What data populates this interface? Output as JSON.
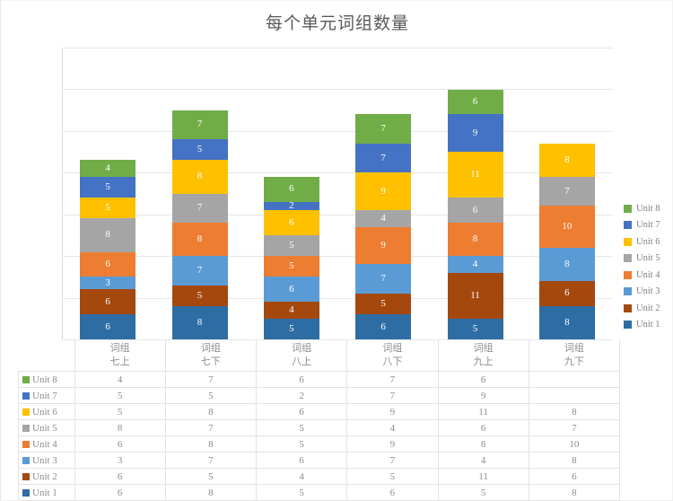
{
  "chart_data": {
    "type": "bar",
    "subtype": "stacked-column",
    "title": "每个单元词组数量",
    "xlabel": "",
    "ylabel": "",
    "ylim": [
      0,
      70
    ],
    "ytick_step": 10,
    "yticks": [
      0,
      10,
      20,
      30,
      40,
      50,
      60,
      70
    ],
    "grid": true,
    "legend_position": "right",
    "categories": [
      "词组\n七上",
      "词组\n七下",
      "词组\n八上",
      "词组\n八下",
      "词组\n九上",
      "词组\n九下"
    ],
    "category_lines": [
      [
        "词组",
        "七上"
      ],
      [
        "词组",
        "七下"
      ],
      [
        "词组",
        "八上"
      ],
      [
        "词组",
        "八下"
      ],
      [
        "词组",
        "九上"
      ],
      [
        "词组",
        "九下"
      ]
    ],
    "series": [
      {
        "name": "Unit 1",
        "color": "#2E6DA4",
        "values": [
          6,
          8,
          5,
          6,
          5,
          8
        ]
      },
      {
        "name": "Unit 2",
        "color": "#A5480E",
        "values": [
          6,
          5,
          4,
          5,
          11,
          6
        ]
      },
      {
        "name": "Unit 3",
        "color": "#5B9BD5",
        "values": [
          3,
          7,
          6,
          7,
          4,
          8
        ]
      },
      {
        "name": "Unit 4",
        "color": "#ED7D31",
        "values": [
          6,
          8,
          5,
          9,
          8,
          10
        ]
      },
      {
        "name": "Unit 5",
        "color": "#A5A5A5",
        "values": [
          8,
          7,
          5,
          4,
          6,
          7
        ]
      },
      {
        "name": "Unit 6",
        "color": "#FFC000",
        "values": [
          5,
          8,
          6,
          9,
          11,
          8
        ]
      },
      {
        "name": "Unit 7",
        "color": "#4472C4",
        "values": [
          5,
          5,
          2,
          7,
          9,
          null
        ]
      },
      {
        "name": "Unit 8",
        "color": "#70AD47",
        "values": [
          4,
          7,
          6,
          7,
          6,
          null
        ]
      }
    ],
    "totals": [
      43,
      55,
      39,
      54,
      60,
      47
    ]
  },
  "legend": {
    "entries": [
      {
        "label": "Unit 8",
        "color": "#70AD47"
      },
      {
        "label": "Unit 7",
        "color": "#4472C4"
      },
      {
        "label": "Unit 6",
        "color": "#FFC000"
      },
      {
        "label": "Unit 5",
        "color": "#A5A5A5"
      },
      {
        "label": "Unit 4",
        "color": "#ED7D31"
      },
      {
        "label": "Unit 3",
        "color": "#5B9BD5"
      },
      {
        "label": "Unit 2",
        "color": "#A5480E"
      },
      {
        "label": "Unit 1",
        "color": "#2E6DA4"
      }
    ]
  },
  "data_table": {
    "column_headers": [
      [
        "词组",
        "七上"
      ],
      [
        "词组",
        "七下"
      ],
      [
        "词组",
        "八上"
      ],
      [
        "词组",
        "八下"
      ],
      [
        "词组",
        "九上"
      ],
      [
        "词组",
        "九下"
      ]
    ],
    "rows": [
      {
        "label": "Unit 8",
        "color": "#70AD47",
        "cells": [
          "4",
          "7",
          "6",
          "7",
          "6",
          ""
        ]
      },
      {
        "label": "Unit 7",
        "color": "#4472C4",
        "cells": [
          "5",
          "5",
          "2",
          "7",
          "9",
          ""
        ]
      },
      {
        "label": "Unit 6",
        "color": "#FFC000",
        "cells": [
          "5",
          "8",
          "6",
          "9",
          "11",
          "8"
        ]
      },
      {
        "label": "Unit 5",
        "color": "#A5A5A5",
        "cells": [
          "8",
          "7",
          "5",
          "4",
          "6",
          "7"
        ]
      },
      {
        "label": "Unit 4",
        "color": "#ED7D31",
        "cells": [
          "6",
          "8",
          "5",
          "9",
          "8",
          "10"
        ]
      },
      {
        "label": "Unit 3",
        "color": "#5B9BD5",
        "cells": [
          "3",
          "7",
          "6",
          "7",
          "4",
          "8"
        ]
      },
      {
        "label": "Unit 2",
        "color": "#A5480E",
        "cells": [
          "6",
          "5",
          "4",
          "5",
          "11",
          "6"
        ]
      },
      {
        "label": "Unit 1",
        "color": "#2E6DA4",
        "cells": [
          "6",
          "8",
          "5",
          "6",
          "5",
          "8"
        ]
      }
    ]
  }
}
